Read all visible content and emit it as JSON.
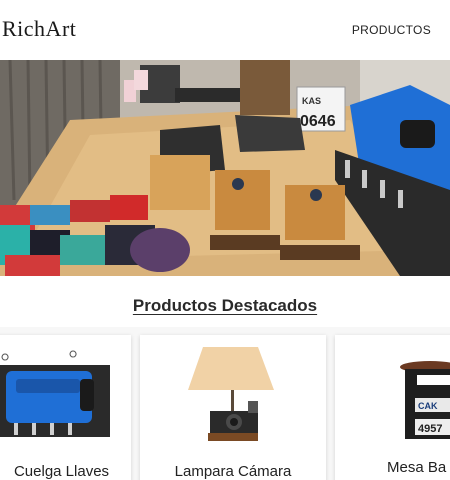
{
  "header": {
    "logo": "RichArt",
    "nav": {
      "productos": "PRODUCTOS"
    }
  },
  "hero": {
    "image_alt": "Taller con piezas de arte reciclado: tapas de motor, bloques de madera y cámaras",
    "plate_text": "KAS 0646"
  },
  "featured": {
    "title": "Productos Destacados",
    "products": [
      {
        "name": "Cuelga Llaves",
        "image": "blue-valve-cover-key-holder"
      },
      {
        "name": "Lampara Cámara",
        "image": "camera-lamp"
      },
      {
        "name": "Mesa Ba",
        "image": "license-plate-side-table"
      }
    ]
  },
  "colors": {
    "accent_blue": "#1f6fd6",
    "wood": "#d9a662",
    "dark": "#1a1a1a"
  }
}
